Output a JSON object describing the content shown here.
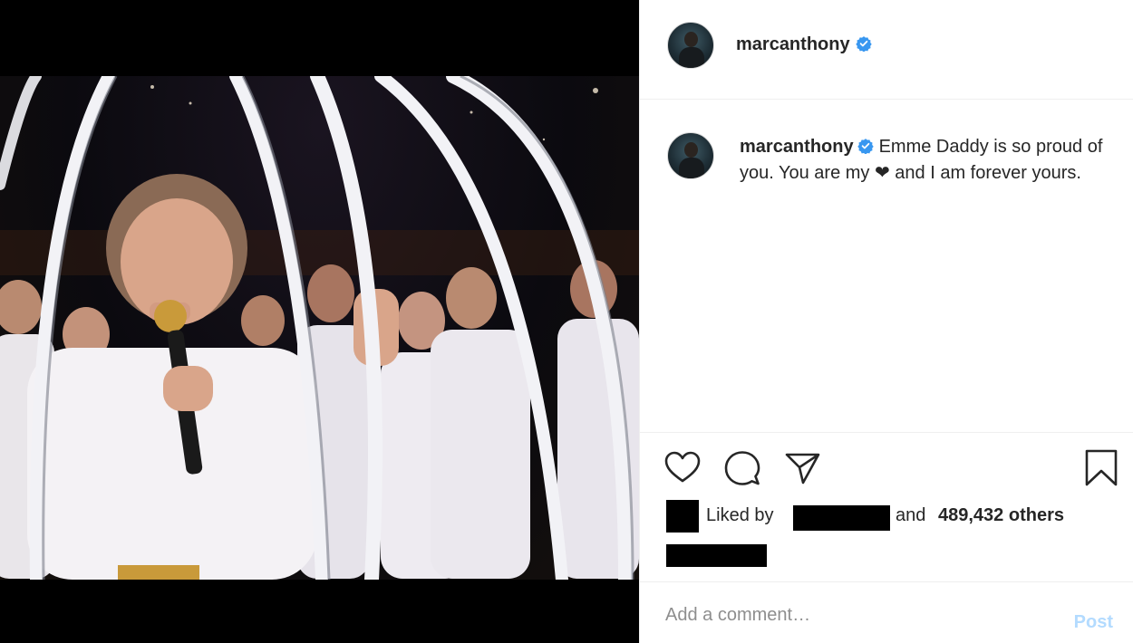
{
  "post": {
    "author": "marcanthony",
    "verified": true,
    "caption_author": "marcanthony",
    "caption_text": "Emme Daddy is so proud of you. You are my ❤ and I am forever yours.",
    "liked_by_prefix": "Liked by",
    "liked_by_and": "and",
    "likes_others": "489,432 others",
    "comment_placeholder": "Add a comment…",
    "post_button": "Post"
  },
  "icons": {
    "like": "heart-outline-icon",
    "comment": "speech-bubble-icon",
    "share": "paper-plane-icon",
    "save": "bookmark-icon",
    "verified": "verified-badge-icon"
  },
  "colors": {
    "verified_blue": "#3897f0",
    "post_disabled": "#b3dbff",
    "text_primary": "#262626",
    "placeholder": "#8e8e8e"
  }
}
